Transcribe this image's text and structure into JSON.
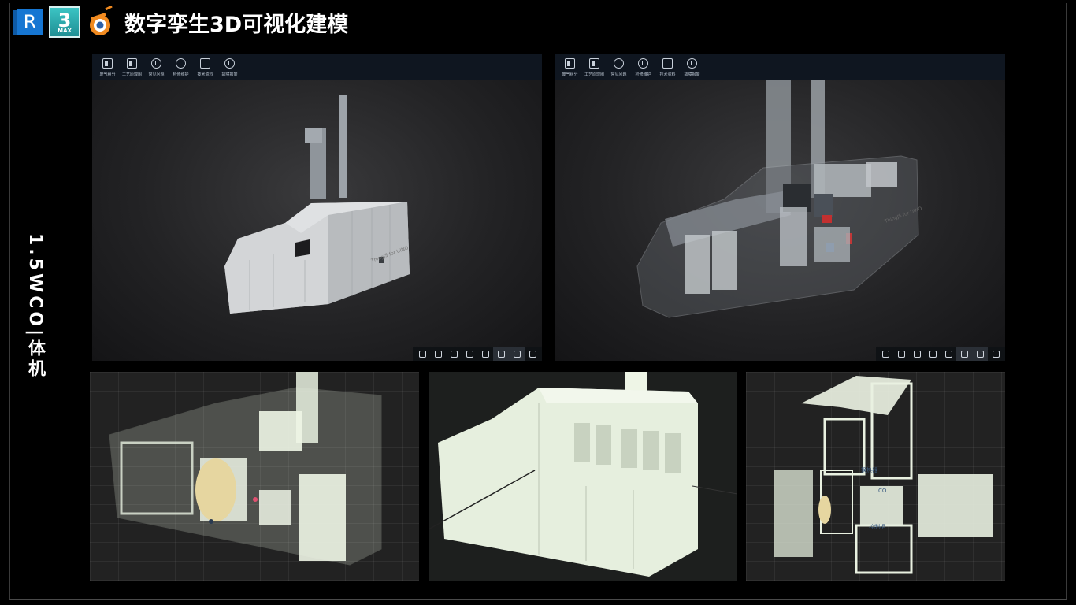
{
  "header": {
    "title": "数字孪生3D可视化建模",
    "logos": [
      {
        "name": "revit-logo",
        "text": "R"
      },
      {
        "name": "3dsmax-logo",
        "text": "3",
        "sub": "MAX"
      },
      {
        "name": "blender-logo"
      }
    ]
  },
  "side_label": "1.5WCO|体机",
  "viewer_left": {
    "toolbar": [
      {
        "label": "废气组分",
        "icon": "panel-icon"
      },
      {
        "label": "工艺原理图",
        "icon": "diagram-icon"
      },
      {
        "label": "常见问题",
        "icon": "question-icon"
      },
      {
        "label": "检修维护",
        "icon": "wrench-icon"
      },
      {
        "label": "技术资料",
        "icon": "document-icon"
      },
      {
        "label": "故障报警",
        "icon": "alert-icon"
      }
    ],
    "bottom_tools": [
      "view-front-icon",
      "view-top-icon",
      "rotate-icon",
      "pan-icon",
      "zoom-icon",
      "reset-icon",
      "fullscreen-icon",
      "settings-icon"
    ]
  },
  "viewer_right": {
    "toolbar": [
      {
        "label": "废气组分",
        "icon": "panel-icon"
      },
      {
        "label": "工艺原理图",
        "icon": "diagram-icon"
      },
      {
        "label": "常见问题",
        "icon": "question-icon"
      },
      {
        "label": "检修维护",
        "icon": "wrench-icon"
      },
      {
        "label": "技术资料",
        "icon": "document-icon"
      },
      {
        "label": "故障报警",
        "icon": "alert-icon"
      }
    ],
    "bottom_tools": [
      "view-front-icon",
      "view-top-icon",
      "rotate-icon",
      "pan-icon",
      "zoom-icon",
      "reset-icon",
      "fullscreen-icon",
      "settings-icon"
    ]
  },
  "exploded_labels": [
    "换热器",
    "CO",
    "控制柜"
  ]
}
